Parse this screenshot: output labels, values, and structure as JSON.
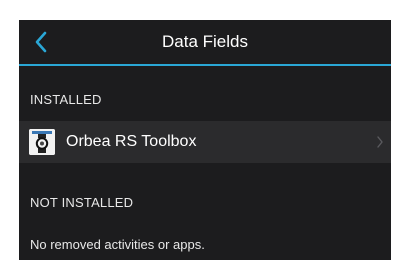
{
  "navbar": {
    "title": "Data Fields",
    "back_icon": "chevron-left-icon",
    "accent_color": "#2aa7d6"
  },
  "installed_section": {
    "header": "INSTALLED",
    "items": [
      {
        "name": "Orbea RS Toolbox",
        "icon": "watch-app-icon",
        "chevron_icon": "chevron-right-icon"
      }
    ]
  },
  "not_installed_section": {
    "header": "NOT INSTALLED",
    "empty_message": "No removed activities or apps."
  },
  "colors": {
    "background": "#1c1c1e",
    "row_background": "#2b2b2d",
    "text": "#ffffff",
    "accent": "#2aa7d6"
  }
}
